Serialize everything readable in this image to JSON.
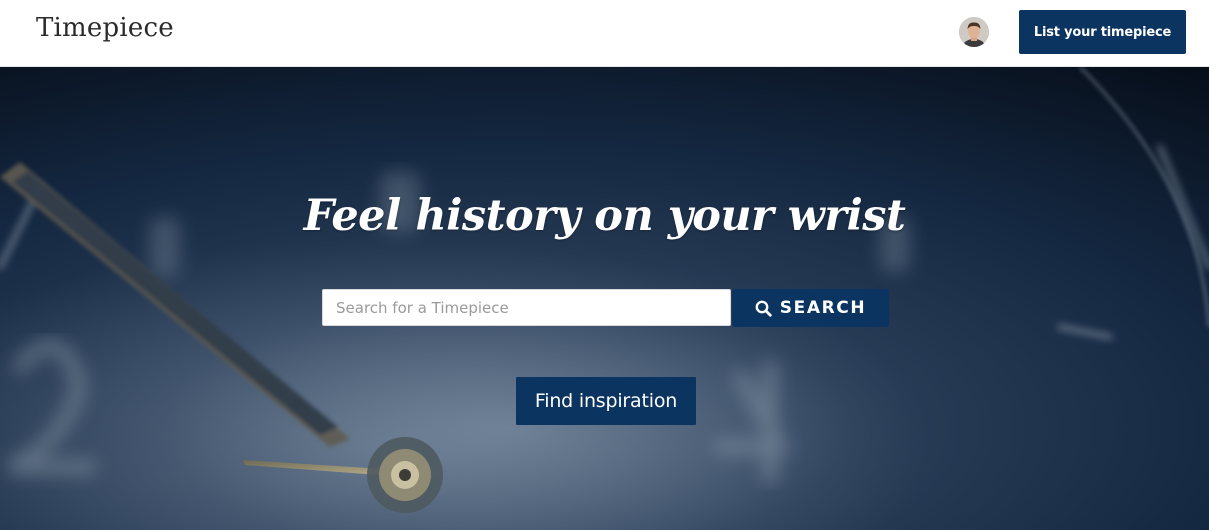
{
  "header": {
    "logo_text": "Timepiece",
    "list_button_label": "List your timepiece"
  },
  "hero": {
    "tagline": "Feel history on your wrist",
    "search": {
      "placeholder": "Search for a Timepiece",
      "value": "",
      "button_label": "SEARCH"
    },
    "inspiration_button_label": "Find inspiration"
  },
  "icons": {
    "search": "search-icon",
    "avatar": "user-avatar"
  },
  "colors": {
    "brand_navy": "#0c3461",
    "header_bg": "#ffffff",
    "hero_bg": "#0d1b2e",
    "tagline_text": "#ffffff"
  }
}
